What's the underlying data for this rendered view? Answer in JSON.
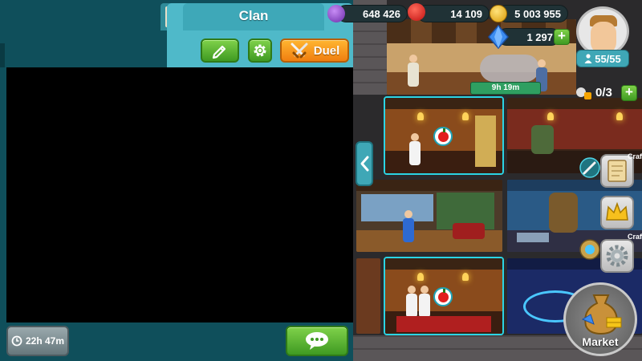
{
  "clan_panel": {
    "title": "Clan",
    "duel_label": "Duel",
    "timer": "22h 47m"
  },
  "resources": {
    "elixir": "648 426",
    "food": "14 109",
    "gold": "5 003 955",
    "gems": "1 297"
  },
  "player": {
    "population": "55/55",
    "workers": "0/3"
  },
  "rooms": {
    "construction_timer": "9h 19m"
  },
  "side": {
    "craft_label": "Craft",
    "market_label": "Market"
  },
  "colors": {
    "clan_header": "#4fb9c9",
    "panel_bg": "#0f4f5b",
    "button_green": "#3f9a22",
    "button_orange": "#f07f10",
    "selection": "#2bd4e4"
  }
}
